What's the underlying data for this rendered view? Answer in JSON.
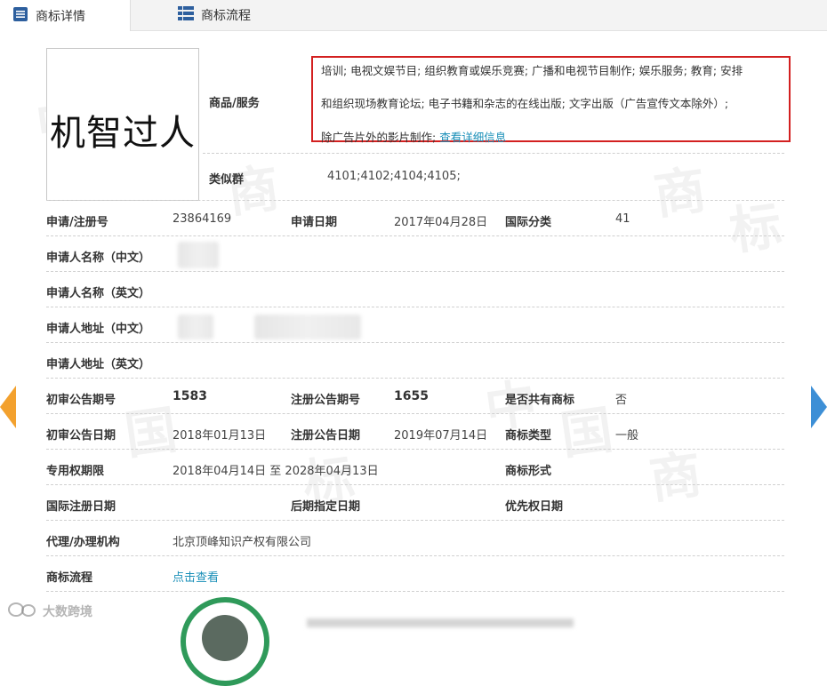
{
  "tabs": {
    "details": "商标详情",
    "process": "商标流程"
  },
  "trademark_image_text": "机智过人",
  "goods_services": {
    "label": "商品/服务",
    "line1": "培训; 电视文娱节目; 组织教育或娱乐竞赛; 广播和电视节目制作; 娱乐服务; 教育; 安排",
    "line2": "和组织现场教育论坛; 电子书籍和杂志的在线出版; 文字出版（广告宣传文本除外）;",
    "line3": "除广告片外的影片制作; ",
    "link": "查看详细信息"
  },
  "similar_group": {
    "label": "类似群",
    "value": "4101;4102;4104;4105;"
  },
  "reg_no": {
    "label": "申请/注册号",
    "value": "23864169"
  },
  "app_date": {
    "label": "申请日期",
    "value": "2017年04月28日"
  },
  "intl_class": {
    "label": "国际分类",
    "value": "41"
  },
  "applicant_cn": {
    "label": "申请人名称（中文）"
  },
  "applicant_en": {
    "label": "申请人名称（英文）"
  },
  "address_cn": {
    "label": "申请人地址（中文）"
  },
  "address_en": {
    "label": "申请人地址（英文）"
  },
  "prelim_no": {
    "label": "初审公告期号",
    "value": "1583"
  },
  "reg_pub_no": {
    "label": "注册公告期号",
    "value": "1655"
  },
  "shared": {
    "label": "是否共有商标",
    "value": "否"
  },
  "prelim_date": {
    "label": "初审公告日期",
    "value": "2018年01月13日"
  },
  "reg_pub_date": {
    "label": "注册公告日期",
    "value": "2019年07月14日"
  },
  "tm_type": {
    "label": "商标类型",
    "value": "一般"
  },
  "exclusive_period": {
    "label": "专用权期限",
    "value": "2018年04月14日 至 2028年04月13日"
  },
  "tm_form": {
    "label": "商标形式"
  },
  "intl_reg_date": {
    "label": "国际注册日期"
  },
  "later_designation": {
    "label": "后期指定日期"
  },
  "priority_date": {
    "label": "优先权日期"
  },
  "agent": {
    "label": "代理/办理机构",
    "value": "北京顶峰知识产权有限公司"
  },
  "flow": {
    "label": "商标流程",
    "link": "点击查看"
  },
  "watermarks": [
    "中",
    "国",
    "商",
    "标"
  ],
  "footer_watermark": "大数跨境",
  "colors": {
    "highlight_border": "#d32020",
    "link": "#1a8fb8",
    "arrow_left": "#f3a12e",
    "arrow_right": "#3d8fd6"
  }
}
